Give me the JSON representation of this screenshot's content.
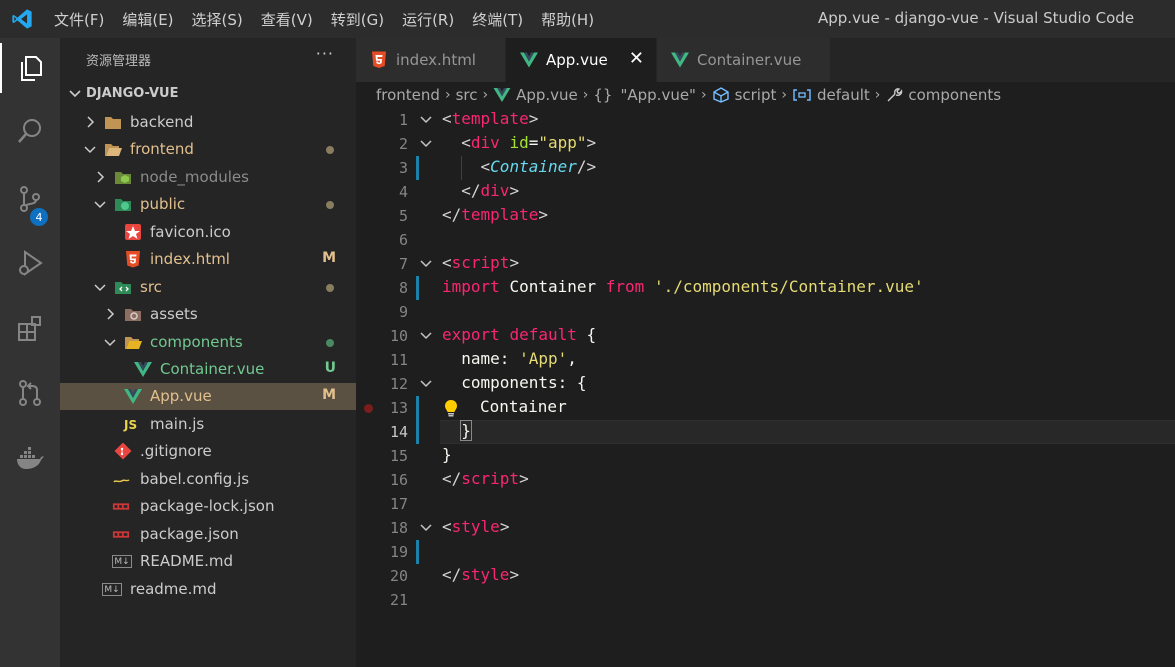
{
  "window": {
    "title": "App.vue - django-vue - Visual Studio Code",
    "menu": [
      "文件(F)",
      "编辑(E)",
      "选择(S)",
      "查看(V)",
      "转到(G)",
      "运行(R)",
      "终端(T)",
      "帮助(H)"
    ]
  },
  "activity": {
    "items": [
      "explorer-icon",
      "search-icon",
      "source-control-icon",
      "run-debug-icon",
      "extensions-icon",
      "pull-requests-icon",
      "docker-icon"
    ],
    "source_control_badge": "4"
  },
  "sidebar": {
    "header": "资源管理器",
    "more": "···",
    "root": "DJANGO-VUE",
    "items": [
      {
        "label": "backend",
        "status": ""
      },
      {
        "label": "frontend",
        "status": ""
      },
      {
        "label": "node_modules",
        "status": ""
      },
      {
        "label": "public",
        "status": ""
      },
      {
        "label": "favicon.ico",
        "status": ""
      },
      {
        "label": "index.html",
        "status": "M"
      },
      {
        "label": "src",
        "status": ""
      },
      {
        "label": "assets",
        "status": ""
      },
      {
        "label": "components",
        "status": ""
      },
      {
        "label": "Container.vue",
        "status": "U"
      },
      {
        "label": "App.vue",
        "status": "M"
      },
      {
        "label": "main.js",
        "status": ""
      },
      {
        "label": ".gitignore",
        "status": ""
      },
      {
        "label": "babel.config.js",
        "status": ""
      },
      {
        "label": "package-lock.json",
        "status": ""
      },
      {
        "label": "package.json",
        "status": ""
      },
      {
        "label": "README.md",
        "status": ""
      },
      {
        "label": "readme.md",
        "status": ""
      }
    ],
    "icon_labels": {
      "js": "JS",
      "md": "M↓"
    }
  },
  "tabs": [
    {
      "label": "index.html"
    },
    {
      "label": "App.vue"
    },
    {
      "label": "Container.vue"
    }
  ],
  "tab_close": "✕",
  "breadcrumbs": [
    "frontend",
    "src",
    "App.vue",
    "\"App.vue\"",
    "script",
    "default",
    "components"
  ],
  "breadcrumb_icons": {
    "braces": "{}"
  },
  "editor": {
    "line_numbers": [
      "1",
      "2",
      "3",
      "4",
      "5",
      "6",
      "7",
      "8",
      "9",
      "10",
      "11",
      "12",
      "13",
      "14",
      "15",
      "16",
      "17",
      "18",
      "19",
      "20",
      "21"
    ],
    "code": {
      "l1_tag": "template",
      "l2_tag": "div",
      "l2_attr": "id",
      "l2_val": "\"app\"",
      "l3_tag": "Container",
      "l4_tag": "div",
      "l5_tag": "template",
      "l7_tag": "script",
      "l8_import": "import",
      "l8_name": "Container",
      "l8_from": "from",
      "l8_path": "'./components/Container.vue'",
      "l10_export": "export",
      "l10_default": "default",
      "l10_brace": "{",
      "l11_key": "name:",
      "l11_val": "'App'",
      "l11_comma": ",",
      "l12_key": "components:",
      "l12_brace": "{",
      "l13_name": "Container",
      "l14_brace": "}",
      "l15_brace": "}",
      "l16_tag": "script",
      "l18_tag": "style",
      "l20_tag": "style"
    }
  },
  "colors": {
    "accent": "#0e70c0",
    "vue_green": "#41b883",
    "modified": "#e2c08d",
    "untracked": "#73c991"
  }
}
